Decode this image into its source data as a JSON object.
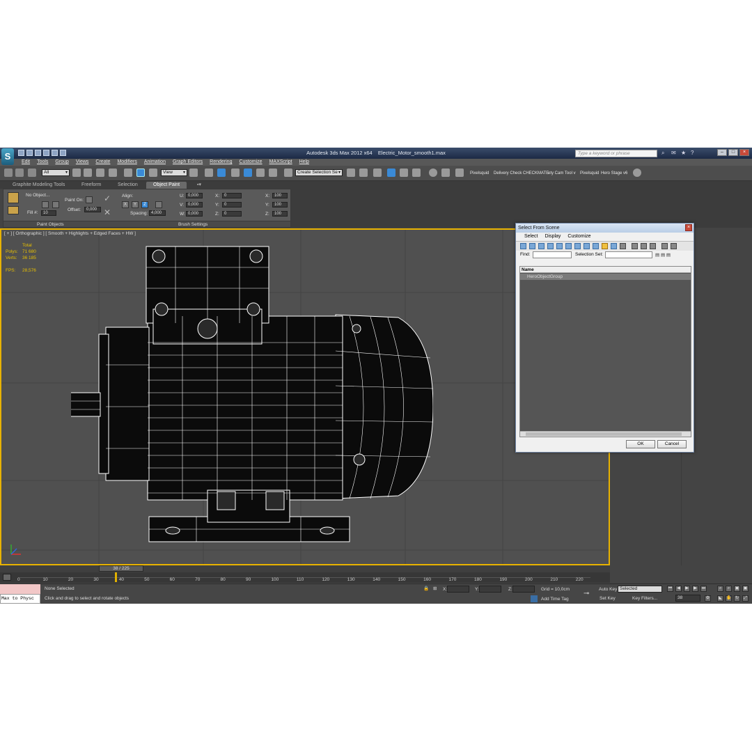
{
  "window": {
    "app_name": "Autodesk 3ds Max  2012 x64",
    "file_name": "Electric_Motor_smooth1.max",
    "search_placeholder": "Type a keyword or phrase"
  },
  "menu": [
    "Edit",
    "Tools",
    "Group",
    "Views",
    "Create",
    "Modifiers",
    "Animation",
    "Graph Editors",
    "Rendering",
    "Customize",
    "MAXScript",
    "Help"
  ],
  "toolbar": {
    "filter_value": "All",
    "ref_coord_value": "View",
    "selection_set_value": "Create Selection Se",
    "plugins": [
      "Pixelsquid",
      "Delivery Check",
      "CHECKMATE",
      "ety Cam Tool v",
      "Pixelsquid",
      "Hero Stage v6"
    ]
  },
  "ribbon_tabs": [
    "Graphite Modeling Tools",
    "Freeform",
    "Selection",
    "Object Paint"
  ],
  "ribbon": {
    "no_object": "No Object...",
    "paint_on": "Paint On:",
    "fill_label": "Fill #:",
    "fill_value": "10",
    "offset_label": "Offset:",
    "offset_value": "0,000",
    "align_label": "Align:",
    "axis_x": "X",
    "axis_y": "Y",
    "axis_z": "Z",
    "spacing_label": "Spacing:",
    "spacing_value": "4,000",
    "u_label": "U:",
    "u_value": "0,000",
    "v_label": "V:",
    "v_value": "0,000",
    "w_label": "W:",
    "w_value": "0,000",
    "rx_label": "X:",
    "rx_value": "0",
    "ry_label": "Y:",
    "ry_value": "0",
    "rz_label": "Z:",
    "rz_value": "0",
    "sx_label": "X:",
    "sx_value": "100",
    "sy_label": "Y:",
    "sy_value": "100",
    "sz_label": "Z:",
    "sz_value": "100",
    "footer_left": "Paint Objects",
    "footer_right": "Brush Settings"
  },
  "viewport": {
    "label": "[ + ] [ Orthographic ] [ Smooth + Highlights + Edged Faces + HW ]",
    "stats_header": "Total",
    "polys_label": "Polys:",
    "polys_value": "71 680",
    "verts_label": "Verts:",
    "verts_value": "36 185",
    "fps_label": "FPS:",
    "fps_value": "28,576"
  },
  "dialog": {
    "title": "Select From Scene",
    "menu": [
      "Select",
      "Display",
      "Customize"
    ],
    "find_label": "Find:",
    "selection_set_label": "Selection Set:",
    "column_name": "Name",
    "rows": [
      "HeroObjectGroup"
    ],
    "ok_label": "OK",
    "cancel_label": "Cancel"
  },
  "timeline": {
    "slider_label": "38 / 225",
    "current_frame": 38,
    "total_frames": 225,
    "ticks": [
      "0",
      "10",
      "20",
      "30",
      "40",
      "50",
      "60",
      "70",
      "80",
      "90",
      "100",
      "110",
      "120",
      "130",
      "140",
      "150",
      "160",
      "170",
      "180",
      "190",
      "200",
      "210",
      "220"
    ]
  },
  "status": {
    "script_text": "Max to Physc",
    "selection_status": "None Selected",
    "prompt": "Click and drag to select and rotate objects",
    "x_label": "X:",
    "y_label": "Y:",
    "z_label": "Z:",
    "grid": "Grid = 10,0cm",
    "add_time_tag": "Add Time Tag",
    "auto_key": "Auto Key",
    "set_key": "Set Key",
    "key_mode_value": "Selected",
    "key_filters": "Key Filters...",
    "frame_value": "38"
  },
  "colors": {
    "viewport_border": "#e8b200",
    "stats_text": "#e8c000",
    "dialog_icon": "#7aa7d6"
  }
}
